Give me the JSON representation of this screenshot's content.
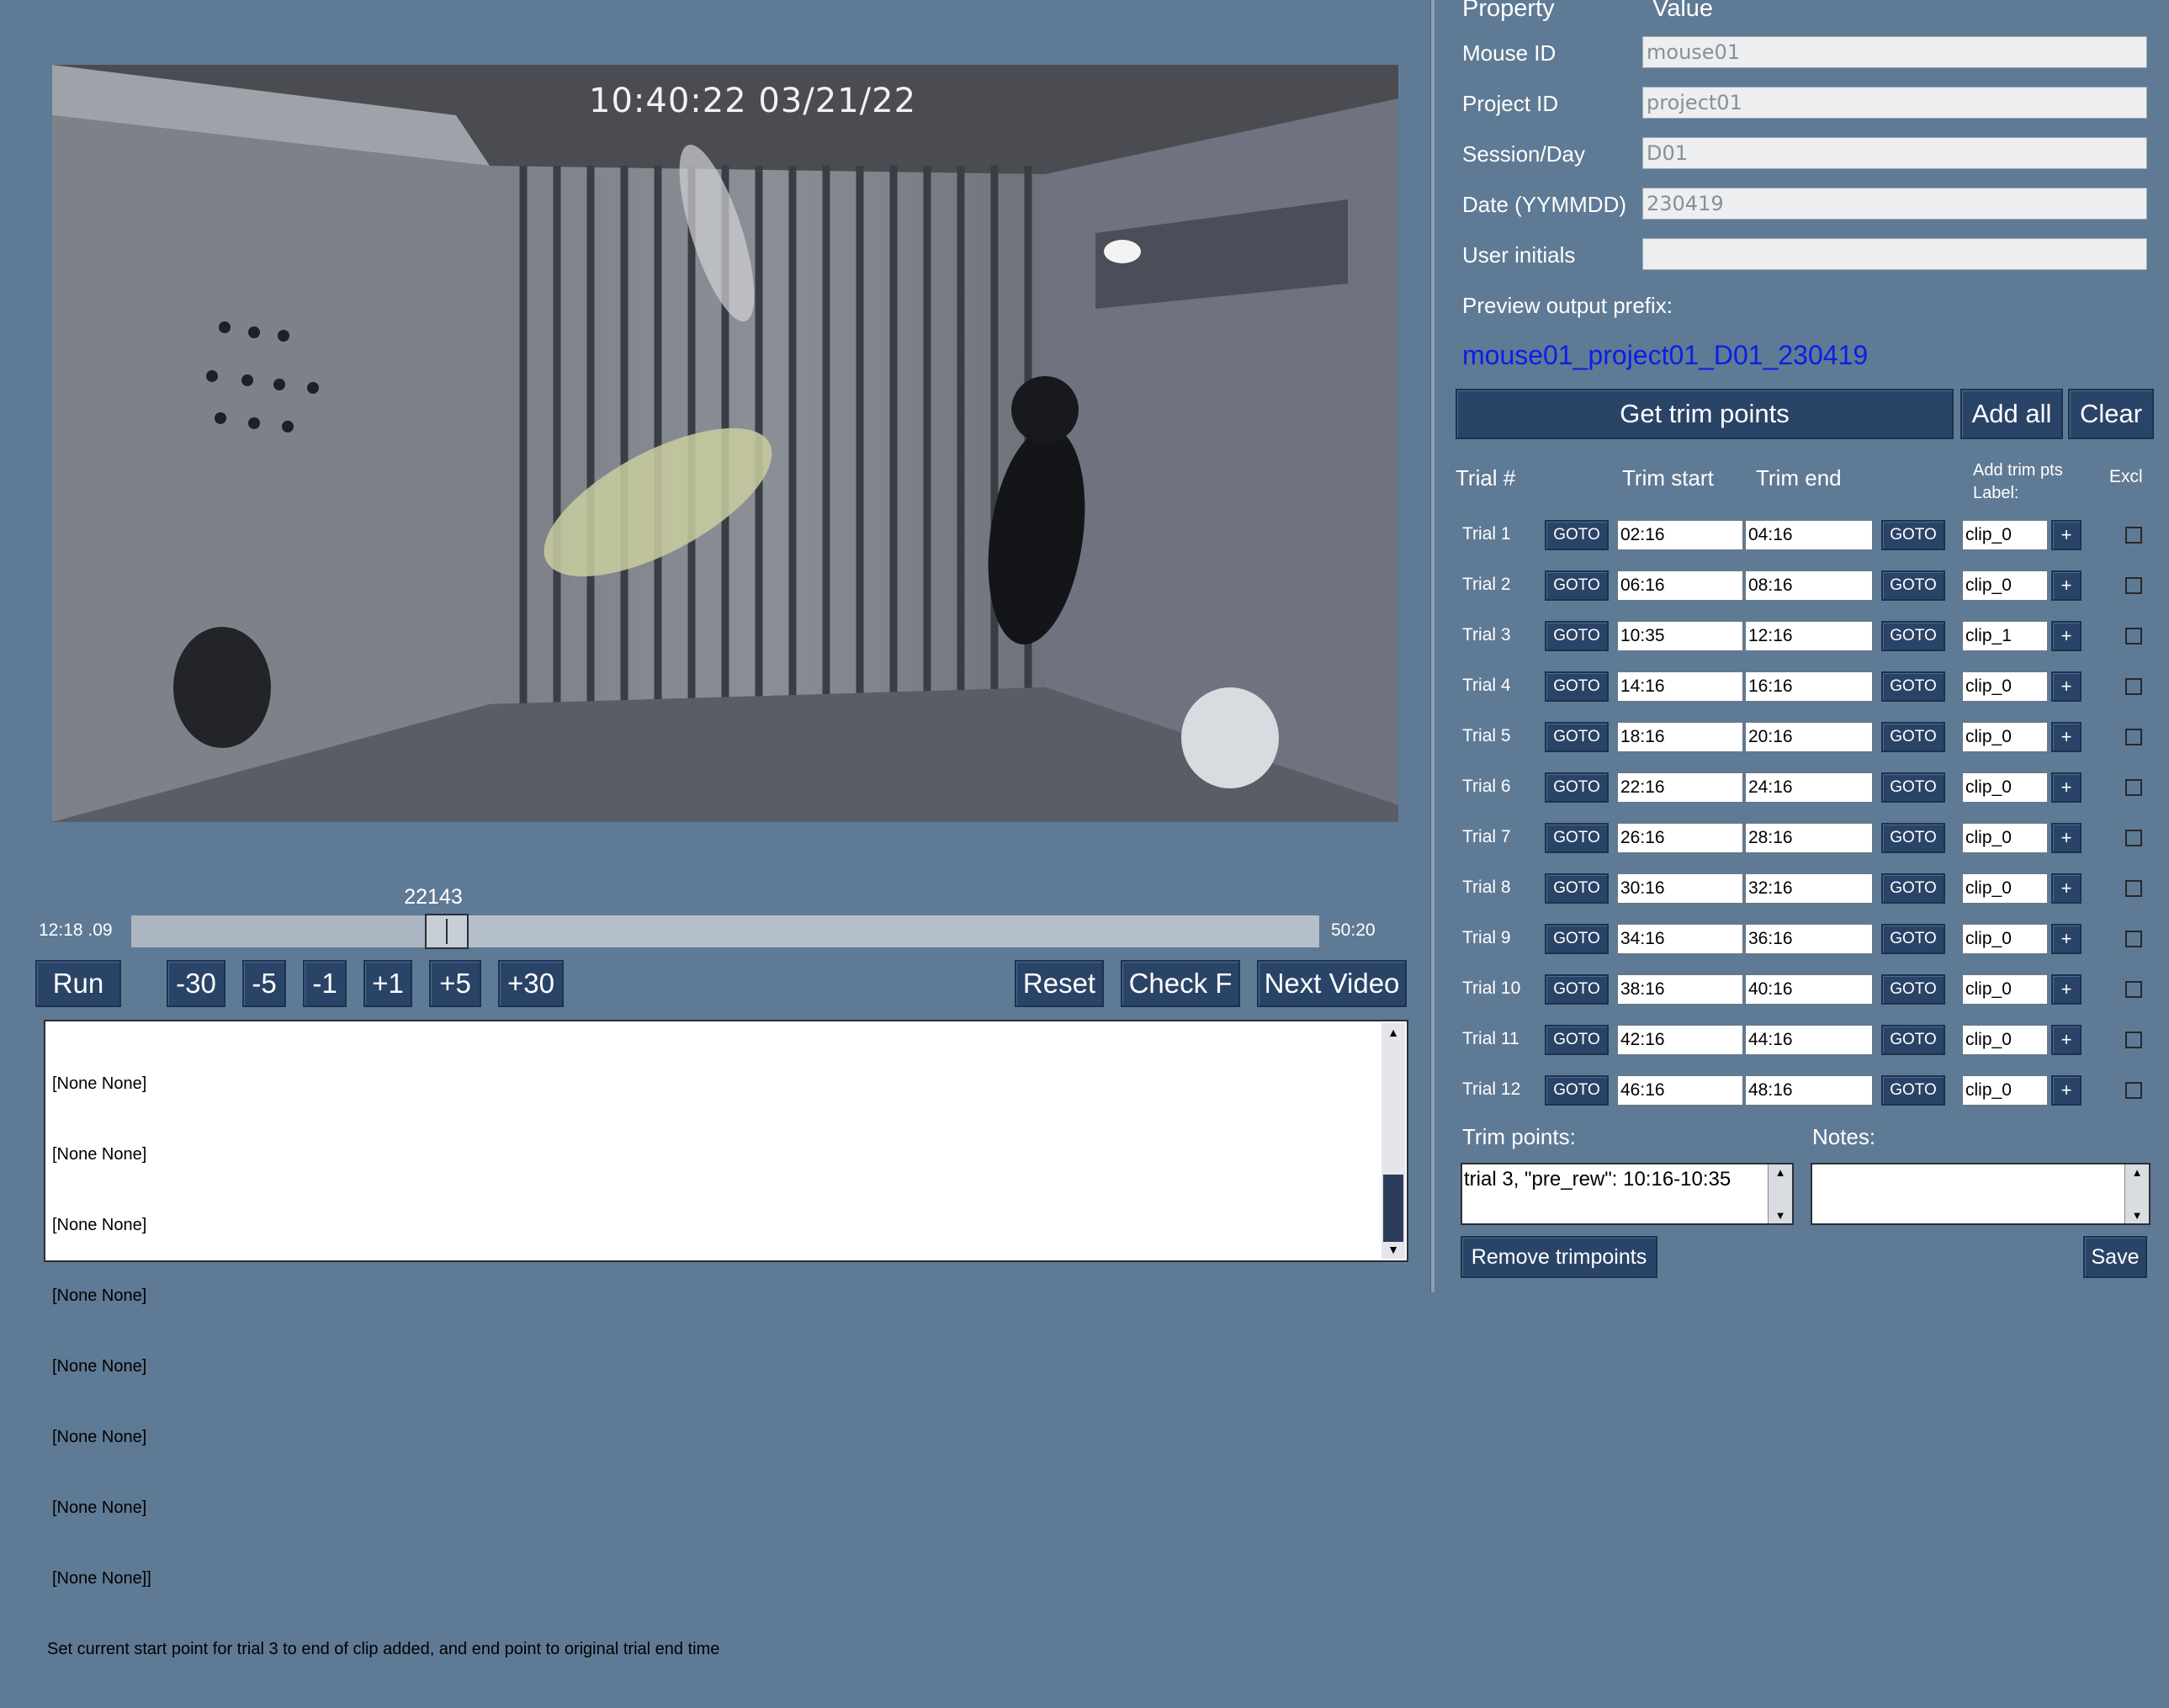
{
  "video": {
    "timestamp": "10:40:22  03/21/22"
  },
  "slider": {
    "frame": "22143",
    "time_start": "12:18 .09",
    "time_end": "50:20",
    "position_fraction": 0.253
  },
  "controls": {
    "run": "Run",
    "m30": "-30",
    "m5": "-5",
    "m1": "-1",
    "p1": "+1",
    "p5": "+5",
    "p30": "+30",
    "reset": "Reset",
    "check": "Check F",
    "next_video": "Next Video"
  },
  "log": {
    "lines": [
      "[None None]",
      "[None None]",
      "[None None]",
      "[None None]",
      "[None None]",
      "[None None]",
      "[None None]",
      "[None None]]",
      "Set current start point for trial 3 to end of clip added, and end point to original trial end time"
    ]
  },
  "properties": {
    "header_property": "Property",
    "header_value": "Value",
    "mouse_id_label": "Mouse ID",
    "mouse_id": "mouse01",
    "project_id_label": "Project ID",
    "project_id": "project01",
    "session_label": "Session/Day",
    "session": "D01",
    "date_label": "Date (YYMMDD)",
    "date": "230419",
    "initials_label": "User initials",
    "initials": "",
    "preview_label": "Preview output prefix:",
    "preview_value": "mouse01_project01_D01_230419"
  },
  "actions": {
    "get_trim": "Get trim points",
    "add_all": "Add all",
    "clear": "Clear"
  },
  "trials_table": {
    "col_trial": "Trial #",
    "col_start": "Trim start",
    "col_end": "Trim end",
    "col_add": "Add trim pts",
    "col_label": "Label:",
    "col_excl": "Excl",
    "goto": "GOTO",
    "plus": "+",
    "rows": [
      {
        "trial": "Trial 1",
        "start": "02:16",
        "end": "04:16",
        "label": "clip_0"
      },
      {
        "trial": "Trial 2",
        "start": "06:16",
        "end": "08:16",
        "label": "clip_0"
      },
      {
        "trial": "Trial 3",
        "start": "10:35",
        "end": "12:16",
        "label": "clip_1"
      },
      {
        "trial": "Trial 4",
        "start": "14:16",
        "end": "16:16",
        "label": "clip_0"
      },
      {
        "trial": "Trial 5",
        "start": "18:16",
        "end": "20:16",
        "label": "clip_0"
      },
      {
        "trial": "Trial 6",
        "start": "22:16",
        "end": "24:16",
        "label": "clip_0"
      },
      {
        "trial": "Trial 7",
        "start": "26:16",
        "end": "28:16",
        "label": "clip_0"
      },
      {
        "trial": "Trial 8",
        "start": "30:16",
        "end": "32:16",
        "label": "clip_0"
      },
      {
        "trial": "Trial 9",
        "start": "34:16",
        "end": "36:16",
        "label": "clip_0"
      },
      {
        "trial": "Trial 10",
        "start": "38:16",
        "end": "40:16",
        "label": "clip_0"
      },
      {
        "trial": "Trial 11",
        "start": "42:16",
        "end": "44:16",
        "label": "clip_0"
      },
      {
        "trial": "Trial 12",
        "start": "46:16",
        "end": "48:16",
        "label": "clip_0"
      }
    ]
  },
  "bottom": {
    "trim_points_label": "Trim points:",
    "trim_points_value": "trial 3, \"pre_rew\": 10:16-10:35",
    "notes_label": "Notes:",
    "notes_value": "",
    "remove": "Remove trimpoints",
    "save": "Save"
  }
}
